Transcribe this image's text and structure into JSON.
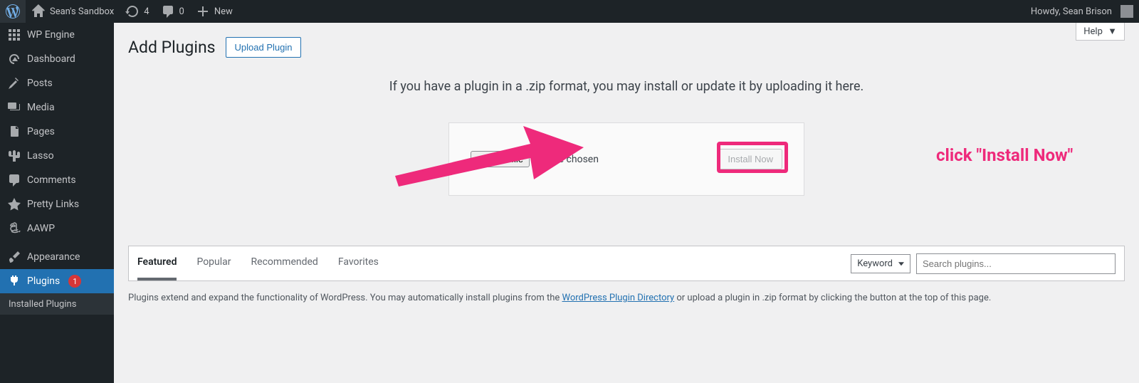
{
  "adminbar": {
    "site_name": "Sean's Sandbox",
    "updates": "4",
    "comments": "0",
    "new": "New",
    "howdy": "Howdy, Sean Brison"
  },
  "sidebar": {
    "items": [
      {
        "label": "WP Engine"
      },
      {
        "label": "Dashboard"
      },
      {
        "label": "Posts"
      },
      {
        "label": "Media"
      },
      {
        "label": "Pages"
      },
      {
        "label": "Lasso"
      },
      {
        "label": "Comments"
      },
      {
        "label": "Pretty Links"
      },
      {
        "label": "AAWP"
      },
      {
        "label": "Appearance"
      },
      {
        "label": "Plugins",
        "badge": "1"
      }
    ],
    "submenu": {
      "installed": "Installed Plugins"
    }
  },
  "main": {
    "help": "Help",
    "title": "Add Plugins",
    "upload_btn": "Upload Plugin",
    "hint": "If you have a plugin in a .zip format, you may install or update it by uploading it here.",
    "choose_file": "Choose file",
    "no_file": "No file chosen",
    "install_now": "Install Now",
    "annotation": "click \"Install Now\"",
    "filter_tabs": [
      "Featured",
      "Popular",
      "Recommended",
      "Favorites"
    ],
    "search_type": "Keyword",
    "search_placeholder": "Search plugins...",
    "desc_pre": "Plugins extend and expand the functionality of WordPress. You may automatically install plugins from the ",
    "desc_link": "WordPress Plugin Directory",
    "desc_post": " or upload a plugin in .zip format by clicking the button at the top of this page."
  }
}
